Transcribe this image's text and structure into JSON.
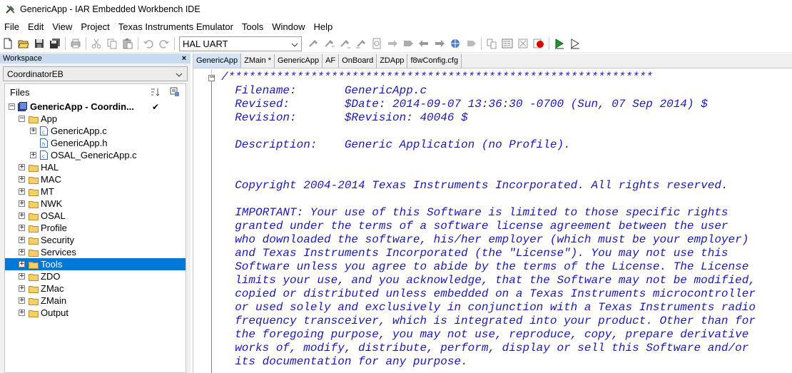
{
  "window": {
    "title": "GenericApp - IAR Embedded Workbench IDE"
  },
  "menu": [
    "File",
    "Edit",
    "View",
    "Project",
    "Texas Instruments Emulator",
    "Tools",
    "Window",
    "Help"
  ],
  "toolbar": {
    "config_value": "HAL UART"
  },
  "workspace": {
    "title": "Workspace",
    "close": "×",
    "config": "CoordinatorEB",
    "files_header": "Files",
    "project_name": "GenericApp - Coordin...",
    "check": "✔",
    "tree": [
      {
        "label": "App",
        "kind": "folder",
        "expanded": true
      },
      {
        "label": "GenericApp.c",
        "kind": "file-c"
      },
      {
        "label": "GenericApp.h",
        "kind": "file-h"
      },
      {
        "label": "OSAL_GenericApp.c",
        "kind": "file-c"
      },
      {
        "label": "HAL",
        "kind": "folder"
      },
      {
        "label": "MAC",
        "kind": "folder"
      },
      {
        "label": "MT",
        "kind": "folder"
      },
      {
        "label": "NWK",
        "kind": "folder"
      },
      {
        "label": "OSAL",
        "kind": "folder"
      },
      {
        "label": "Profile",
        "kind": "folder"
      },
      {
        "label": "Security",
        "kind": "folder"
      },
      {
        "label": "Services",
        "kind": "folder"
      },
      {
        "label": "Tools",
        "kind": "folder",
        "selected": true
      },
      {
        "label": "ZDO",
        "kind": "folder"
      },
      {
        "label": "ZMac",
        "kind": "folder"
      },
      {
        "label": "ZMain",
        "kind": "folder"
      },
      {
        "label": "Output",
        "kind": "folder"
      }
    ]
  },
  "editor": {
    "tabs": [
      "GenericApp",
      "ZMain *",
      "GenericApp",
      "AF",
      "OnBoard",
      "ZDApp",
      "f8wConfig.cfg"
    ],
    "active_tab_index": 0,
    "fold_symbol": "−",
    "lines": [
      "/**************************************************************",
      "  Filename:       GenericApp.c",
      "  Revised:        $Date: 2014-09-07 13:36:30 -0700 (Sun, 07 Sep 2014) $",
      "  Revision:       $Revision: 40046 $",
      "",
      "  Description:    Generic Application (no Profile).",
      "",
      "",
      "  Copyright 2004-2014 Texas Instruments Incorporated. All rights reserved.",
      "",
      "  IMPORTANT: Your use of this Software is limited to those specific rights",
      "  granted under the terms of a software license agreement between the user",
      "  who downloaded the software, his/her employer (which must be your employer)",
      "  and Texas Instruments Incorporated (the \"License\"). You may not use this",
      "  Software unless you agree to abide by the terms of the License. The License",
      "  limits your use, and you acknowledge, that the Software may not be modified,",
      "  copied or distributed unless embedded on a Texas Instruments microcontroller",
      "  or used solely and exclusively in conjunction with a Texas Instruments radio",
      "  frequency transceiver, which is integrated into your product. Other than for",
      "  the foregoing purpose, you may not use, reproduce, copy, prepare derivative",
      "  works of, modify, distribute, perform, display or sell this Software and/or",
      "  its documentation for any purpose."
    ]
  }
}
